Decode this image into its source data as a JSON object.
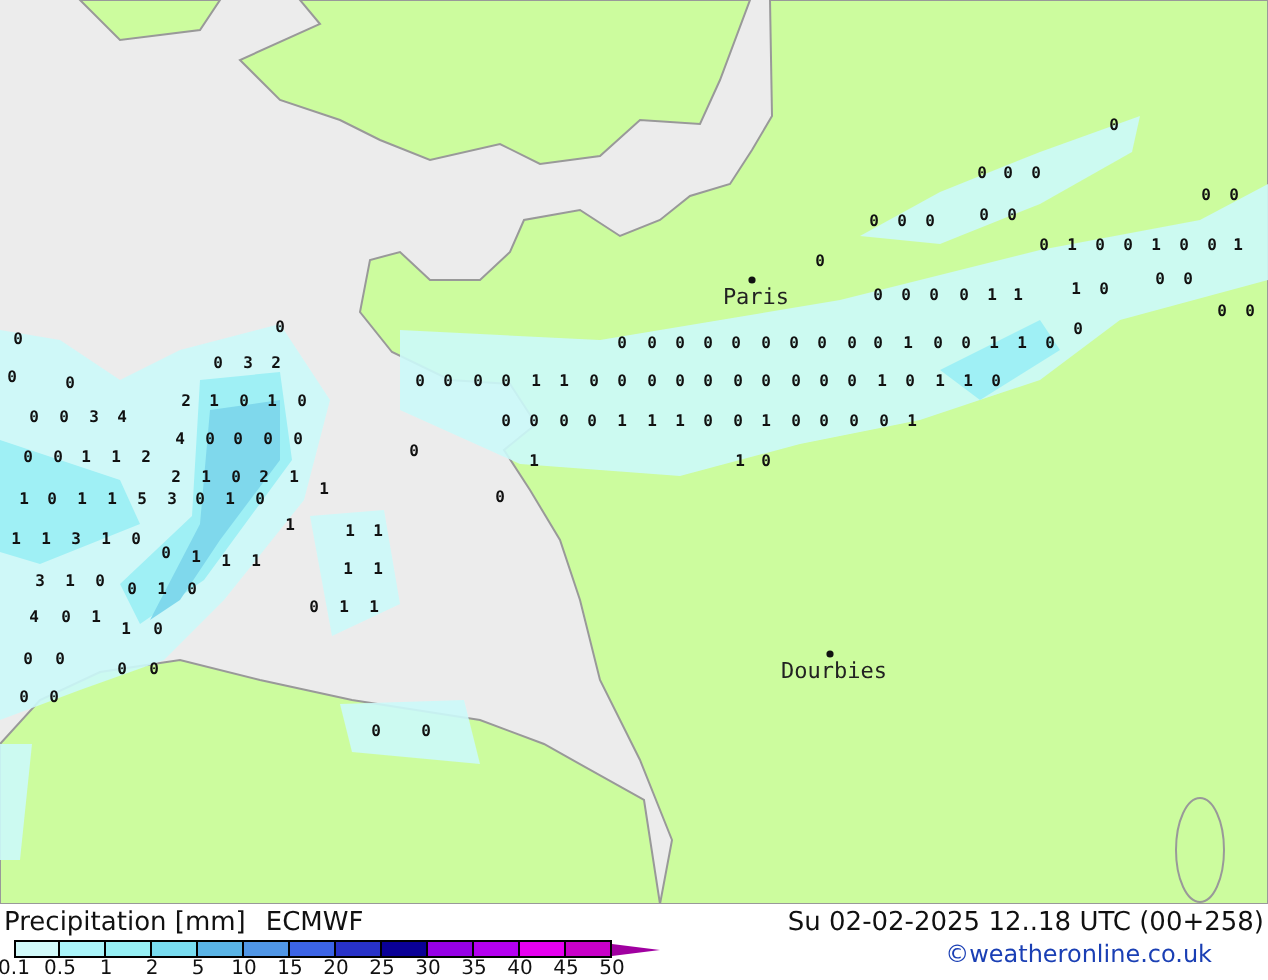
{
  "map": {
    "cities": [
      {
        "name": "Paris"
      },
      {
        "name": "Dourbies"
      }
    ],
    "values": [
      "0",
      "0",
      "0",
      "0",
      "0",
      "0",
      "0",
      "0",
      "0",
      "0",
      "1",
      "0",
      "0",
      "1",
      "1",
      "0",
      "0",
      "0",
      "0",
      "0",
      "1",
      "1",
      "0",
      "0",
      "0",
      "0",
      "0",
      "0",
      "0",
      "0",
      "0",
      "0",
      "1",
      "0",
      "1",
      "1",
      "0",
      "0",
      "0",
      "0",
      "0",
      "1",
      "1",
      "1",
      "0",
      "0",
      "1",
      "0",
      "0",
      "0",
      "0",
      "1",
      "0",
      "0",
      "0",
      "0",
      "1",
      "1",
      "0",
      "0",
      "0",
      "0",
      "0",
      "0",
      "0",
      "0",
      "0",
      "0",
      "1",
      "0",
      "0",
      "1",
      "0",
      "0",
      "1",
      "0",
      "0",
      "0",
      "0",
      "1",
      "0",
      "0",
      "0",
      "0",
      "0",
      "1",
      "1",
      "0",
      "0",
      "0",
      "0",
      "3",
      "2",
      "2",
      "1",
      "0",
      "1",
      "0",
      "0",
      "0",
      "0",
      "0",
      "0",
      "3",
      "4",
      "4",
      "0",
      "0",
      "0",
      "0",
      "0",
      "0",
      "1",
      "1",
      "2",
      "2",
      "1",
      "0",
      "2",
      "1",
      "1",
      "1",
      "0",
      "1",
      "1",
      "5",
      "3",
      "0",
      "1",
      "0",
      "1",
      "1",
      "1",
      "1",
      "1",
      "3",
      "1",
      "0",
      "0",
      "1",
      "1",
      "1",
      "1",
      "1",
      "3",
      "1",
      "0",
      "0",
      "1",
      "0",
      "0",
      "1",
      "1",
      "4",
      "0",
      "1",
      "1",
      "0",
      "0",
      "0",
      "0",
      "0",
      "0",
      "0",
      "0",
      "0",
      "0"
    ]
  },
  "footer": {
    "title": "Precipitation [mm]",
    "model": "ECMWF",
    "valid_time": "Su 02-02-2025 12..18 UTC (00+258)",
    "credit": "©weatheronline.co.uk"
  },
  "legend": {
    "labels": [
      "0.1",
      "0.5",
      "1",
      "2",
      "5",
      "10",
      "15",
      "20",
      "25",
      "30",
      "35",
      "40",
      "45",
      "50"
    ],
    "colors": [
      {
        "color": "#d2fafa"
      },
      {
        "color": "#aaf5fa"
      },
      {
        "color": "#96f0f5"
      },
      {
        "color": "#78dcf0"
      },
      {
        "color": "#5ab4e6"
      },
      {
        "color": "#5096e6"
      },
      {
        "color": "#3c64e6"
      },
      {
        "color": "#2832c8"
      },
      {
        "color": "#0a0096"
      },
      {
        "color": "#9600e6"
      },
      {
        "color": "#b400f0"
      },
      {
        "color": "#e600f0"
      },
      {
        "color": "#c800c8"
      },
      {
        "kind": "arrow",
        "color": "#a000a0"
      }
    ]
  }
}
